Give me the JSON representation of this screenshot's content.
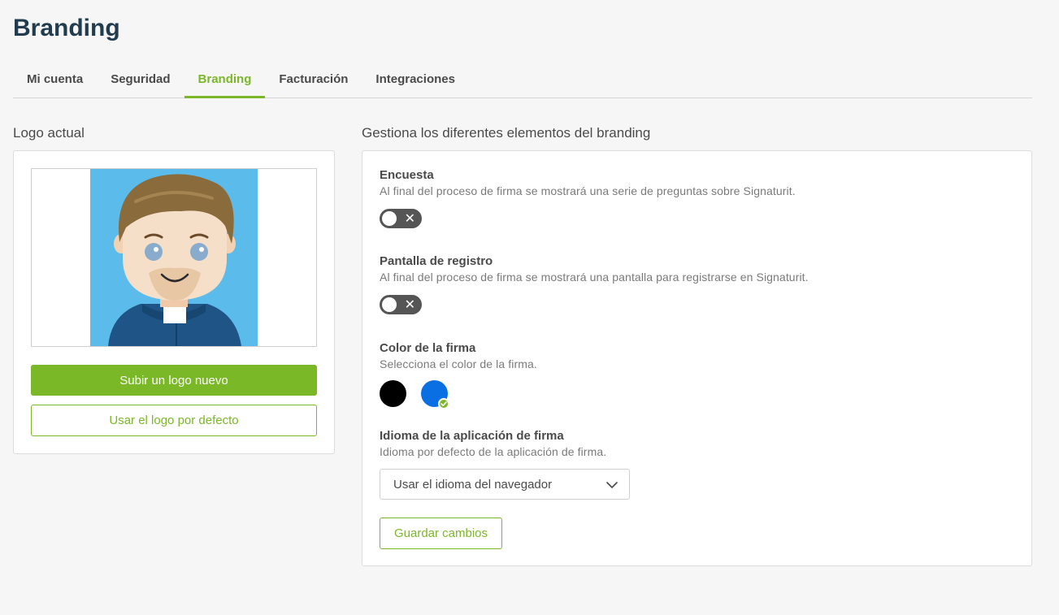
{
  "page": {
    "title": "Branding"
  },
  "tabs": [
    {
      "label": "Mi cuenta",
      "active": false
    },
    {
      "label": "Seguridad",
      "active": false
    },
    {
      "label": "Branding",
      "active": true
    },
    {
      "label": "Facturación",
      "active": false
    },
    {
      "label": "Integraciones",
      "active": false
    }
  ],
  "logo_panel": {
    "title": "Logo actual",
    "upload_button": "Subir un logo nuevo",
    "default_button": "Usar el logo por defecto"
  },
  "branding_panel": {
    "title": "Gestiona los diferentes elementos del branding",
    "survey": {
      "title": "Encuesta",
      "description": "Al final del proceso de firma se mostrará una serie de preguntas sobre Signaturit.",
      "enabled": false
    },
    "registration": {
      "title": "Pantalla de registro",
      "description": "Al final del proceso de firma se mostrará una pantalla para registrarse en Signaturit.",
      "enabled": false
    },
    "signature_color": {
      "title": "Color de la firma",
      "description": "Selecciona el color de la firma.",
      "options": [
        "#000000",
        "#0a6fe3"
      ],
      "selected": "#0a6fe3"
    },
    "language": {
      "title": "Idioma de la aplicación de firma",
      "description": "Idioma por defecto de la aplicación de firma.",
      "selected": "Usar el idioma del navegador"
    },
    "save_button": "Guardar cambios"
  },
  "colors": {
    "accent": "#7ab828",
    "title": "#213c4e"
  }
}
